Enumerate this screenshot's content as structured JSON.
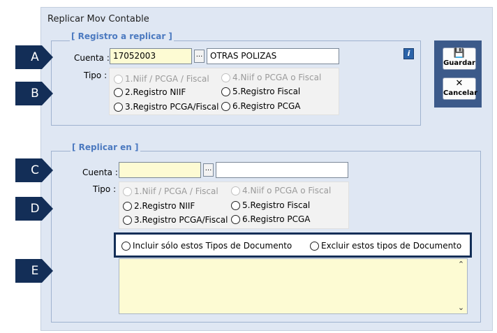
{
  "window": {
    "title": "Replicar Mov Contable"
  },
  "callouts": [
    "A",
    "B",
    "C",
    "D",
    "E"
  ],
  "source": {
    "group_title": "[ Registro a replicar ]",
    "cuenta_label": "Cuenta :",
    "cuenta_code": "17052003",
    "cuenta_name": "OTRAS POLIZAS",
    "browse_label": "...",
    "tipo_label": "Tipo :",
    "options": [
      {
        "label": "1.Niif / PCGA / Fiscal",
        "enabled": false,
        "selected": false
      },
      {
        "label": "4.Niif o PCGA o Fiscal",
        "enabled": false,
        "selected": false
      },
      {
        "label": "2.Registro NIIF",
        "enabled": true,
        "selected": false
      },
      {
        "label": "5.Registro Fiscal",
        "enabled": true,
        "selected": false
      },
      {
        "label": "3.Registro PCGA/Fiscal",
        "enabled": true,
        "selected": false
      },
      {
        "label": "6.Registro PCGA",
        "enabled": true,
        "selected": false
      }
    ]
  },
  "target": {
    "group_title": "[ Replicar en ]",
    "cuenta_label": "Cuenta :",
    "cuenta_code": "",
    "cuenta_name": "",
    "browse_label": "...",
    "tipo_label": "Tipo :",
    "options": [
      {
        "label": "1.Niif / PCGA / Fiscal",
        "enabled": false,
        "selected": false
      },
      {
        "label": "4.Niif o PCGA o Fiscal",
        "enabled": false,
        "selected": false
      },
      {
        "label": "2.Registro NIIF",
        "enabled": true,
        "selected": false
      },
      {
        "label": "5.Registro Fiscal",
        "enabled": true,
        "selected": false
      },
      {
        "label": "3.Registro PCGA/Fiscal",
        "enabled": true,
        "selected": false
      },
      {
        "label": "6.Registro PCGA",
        "enabled": true,
        "selected": false
      }
    ]
  },
  "document_filter": {
    "include_label": "Incluir sólo estos Tipos de Documento",
    "exclude_label": "Excluir estos tipos de Documento",
    "list_text": ""
  },
  "actions": {
    "save_label": "Guardar",
    "cancel_label": "Cancelar"
  },
  "icons": {
    "info": "info-icon",
    "save": "floppy-disk-icon",
    "cancel": "close-icon"
  },
  "colors": {
    "callout": "#132e57",
    "accent_title": "#4c7ac0",
    "window_bg": "#dfe7f3",
    "input_yellow": "#fdfbd3",
    "action_panel": "#3c5a8a"
  }
}
